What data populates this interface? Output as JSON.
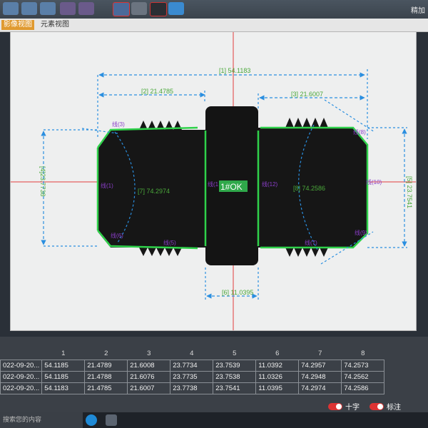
{
  "toolbar": {
    "right_text": "精加"
  },
  "tabs": [
    {
      "label": "影像视图"
    },
    {
      "label": "元素视图"
    }
  ],
  "measure_labels": {
    "d1": "[1] 54.1183",
    "d2": "[2] 21.4785",
    "d3": "[3] 21.6007",
    "d4": "[4]23.7738",
    "d5": "[5] 23.7541",
    "d6": "[6] 11.0395",
    "d7": "[7] 74.2974",
    "d8": "[8] 74.2586",
    "result": "1#OK",
    "line1": "线(1)",
    "line3": "线(3)",
    "line5": "线(5)",
    "line6": "线(6)",
    "line7": "线(7)",
    "line8": "线(8)",
    "line9": "线(9)",
    "line10": "线(10)",
    "line11": "线(1",
    "line12": "线(12)"
  },
  "table": {
    "headers": [
      "",
      "1",
      "2",
      "3",
      "4",
      "5",
      "6",
      "7",
      "8"
    ],
    "rows": [
      [
        "022-09-20...",
        "54.1185",
        "21.4789",
        "21.6008",
        "23.7734",
        "23.7539",
        "11.0392",
        "74.2957",
        "74.2573"
      ],
      [
        "022-09-20...",
        "54.1185",
        "21.4788",
        "21.6076",
        "23.7735",
        "23.7538",
        "11.0326",
        "74.2948",
        "74.2562"
      ],
      [
        "022-09-20...",
        "54.1183",
        "21.4785",
        "21.6007",
        "23.7738",
        "23.7541",
        "11.0395",
        "74.2974",
        "74.2586"
      ]
    ]
  },
  "controls": {
    "crosshair_label": "十字",
    "annotate_label": "标注"
  },
  "taskbar": {
    "search_placeholder": "搜索您的内容"
  },
  "colors": {
    "accent_orange": "#e09a30",
    "dim_blue": "#2a8fe0",
    "edge_green": "#2fd14a",
    "label_purple": "#8a3ec8",
    "ok_green": "#2fa84a"
  }
}
